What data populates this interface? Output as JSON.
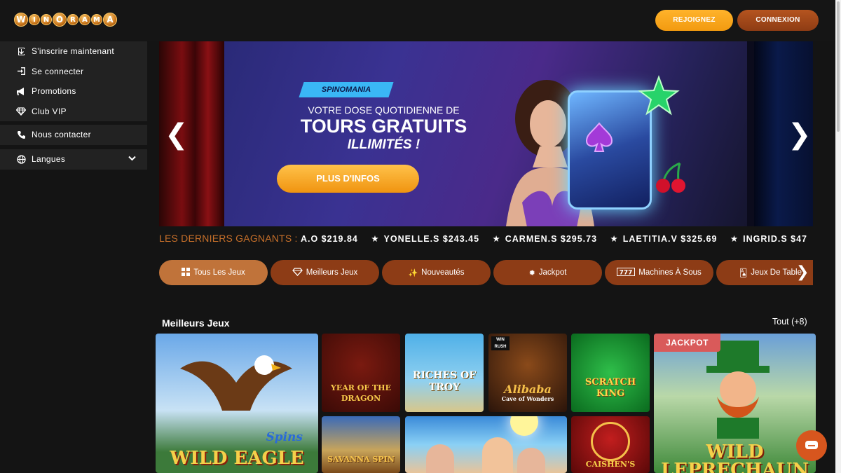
{
  "header": {
    "logo_letters": [
      "W",
      "I",
      "N",
      "O",
      "R",
      "A",
      "M",
      "A"
    ],
    "join_label": "REJOIGNEZ",
    "login_label": "CONNEXION"
  },
  "sidebar": {
    "items": [
      {
        "label": "S'inscrire maintenant",
        "icon": "signup-icon"
      },
      {
        "label": "Se connecter",
        "icon": "login-icon"
      },
      {
        "label": "Promotions",
        "icon": "megaphone-icon"
      },
      {
        "label": "Club VIP",
        "icon": "diamond-icon"
      }
    ],
    "contact": {
      "label": "Nous contacter",
      "icon": "phone-icon"
    },
    "languages": {
      "label": "Langues",
      "icon": "globe-icon"
    }
  },
  "banner": {
    "badge": "SPINOMANIA",
    "subtitle": "VOTRE DOSE QUOTIDIENNE DE",
    "title": "TOURS GRATUITS",
    "title2": "ILLIMITÉS !",
    "cta": "PLUS D'INFOS"
  },
  "winners": {
    "label": "LES DERNIERS GAGNANTS :",
    "first": "A.O $219.84",
    "entries": [
      "YONELLE.S $243.45",
      "CARMEN.S $295.73",
      "LAETITIA.V $325.69",
      "INGRID.S $47"
    ]
  },
  "tabs": [
    {
      "label": "Tous Les Jeux",
      "icon": "grid-icon",
      "active": true
    },
    {
      "label": "Meilleurs Jeux",
      "icon": "diamond-icon"
    },
    {
      "label": "Nouveautés",
      "icon": "sparkle-icon"
    },
    {
      "label": "Jackpot",
      "icon": "jackpot-icon"
    },
    {
      "label": "Machines À Sous",
      "icon": "slot-icon"
    },
    {
      "label": "Jeux De Table",
      "icon": "cards-icon"
    }
  ],
  "games_section": {
    "title": "Meilleurs Jeux",
    "more": "Tout (+8)",
    "jackpot_badge": "JACKPOT",
    "games": [
      {
        "title": "Wild Eagle",
        "subtitle": "Spins"
      },
      {
        "title": "Year of the Dragon"
      },
      {
        "title": "Riches of Troy"
      },
      {
        "title": "Alibaba",
        "subtitle": "Cave of Wonders",
        "tag": "WIN RUSH"
      },
      {
        "title": "Scratch King"
      },
      {
        "title": "Wild Leprechaun"
      },
      {
        "title": "Savanna Spin"
      },
      {
        "title": ""
      },
      {
        "title": "Caishen's"
      }
    ]
  },
  "colors": {
    "accent": "#f29a10",
    "brand_brown": "#8d3c16",
    "jackpot": "#d95a5a"
  }
}
